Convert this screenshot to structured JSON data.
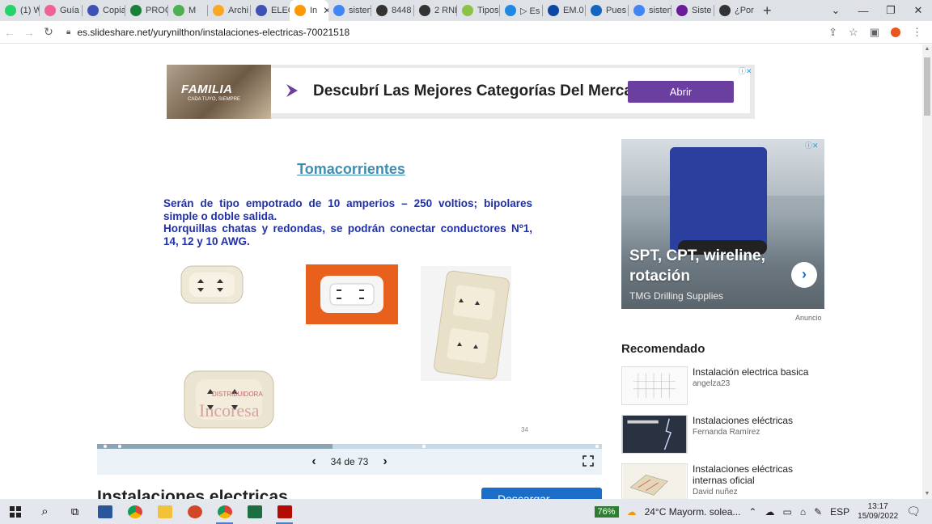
{
  "browser": {
    "tabs": [
      {
        "label": "(1) W",
        "color": "#25d366"
      },
      {
        "label": "Guía",
        "color": "#f06292"
      },
      {
        "label": "Copia",
        "color": "#3f51b5"
      },
      {
        "label": "PROG",
        "color": "#188038"
      },
      {
        "label": "M",
        "color": "#4caf50"
      },
      {
        "label": "Archi",
        "color": "#f9a825"
      },
      {
        "label": "ELEC",
        "color": "#3f51b5"
      },
      {
        "label": "In",
        "color": "#ff9800",
        "active": true
      },
      {
        "label": "sisten",
        "color": "#4285f4"
      },
      {
        "label": "8448",
        "color": "#333333"
      },
      {
        "label": "2 RNI",
        "color": "#333333"
      },
      {
        "label": "Tipos",
        "color": "#8bc34a"
      },
      {
        "label": "▷ Es",
        "color": "#1e88e5"
      },
      {
        "label": "EM.0",
        "color": "#0d47a1"
      },
      {
        "label": "Pues",
        "color": "#1565c0"
      },
      {
        "label": "sisten",
        "color": "#4285f4"
      },
      {
        "label": "Siste",
        "color": "#6a1b9a"
      },
      {
        "label": "¿Por",
        "color": "#333333"
      }
    ],
    "url": "es.slideshare.net/yurynilthon/instalaciones-electricas-70021518"
  },
  "top_ad": {
    "brand": "FAMILIA",
    "brand_sub": "CADA TUYO, SIEMPRE",
    "headline": "Descubrí Las Mejores Categorías Del Mercado",
    "cta": "Abrir"
  },
  "slide": {
    "title": "Tomacorrientes",
    "paragraph1": "Serán de tipo empotrado de 10 amperios – 250 voltios; bipolares simple o doble salida.",
    "paragraph2": "Horquillas chatas y redondas, se podrán conectar conductores Nº1, 14, 12 y 10 AWG.",
    "watermark": "DISTRIBUIDORA Incoresa",
    "page_number": "34"
  },
  "viewer": {
    "progress": 0.4658,
    "counter": "34 de 73"
  },
  "below": {
    "title": "Instalaciones electricas",
    "download": "Descargar"
  },
  "side_ad": {
    "headline": "SPT, CPT, wireline, rotación",
    "advertiser": "TMG Drilling Supplies",
    "label": "Anuncio"
  },
  "recommended": {
    "heading": "Recomendado",
    "items": [
      {
        "title": "Instalación electrica basica",
        "author": "angelza23"
      },
      {
        "title": "Instalaciones eléctricas",
        "author": "Fernanda Ramírez"
      },
      {
        "title": "Instalaciones eléctricas internas oficial",
        "author": "David nuñez"
      }
    ]
  },
  "taskbar": {
    "battery": "76%",
    "weather": "24°C  Mayorm. solea...",
    "lang": "ESP",
    "time": "13:17",
    "date": "15/09/2022"
  }
}
